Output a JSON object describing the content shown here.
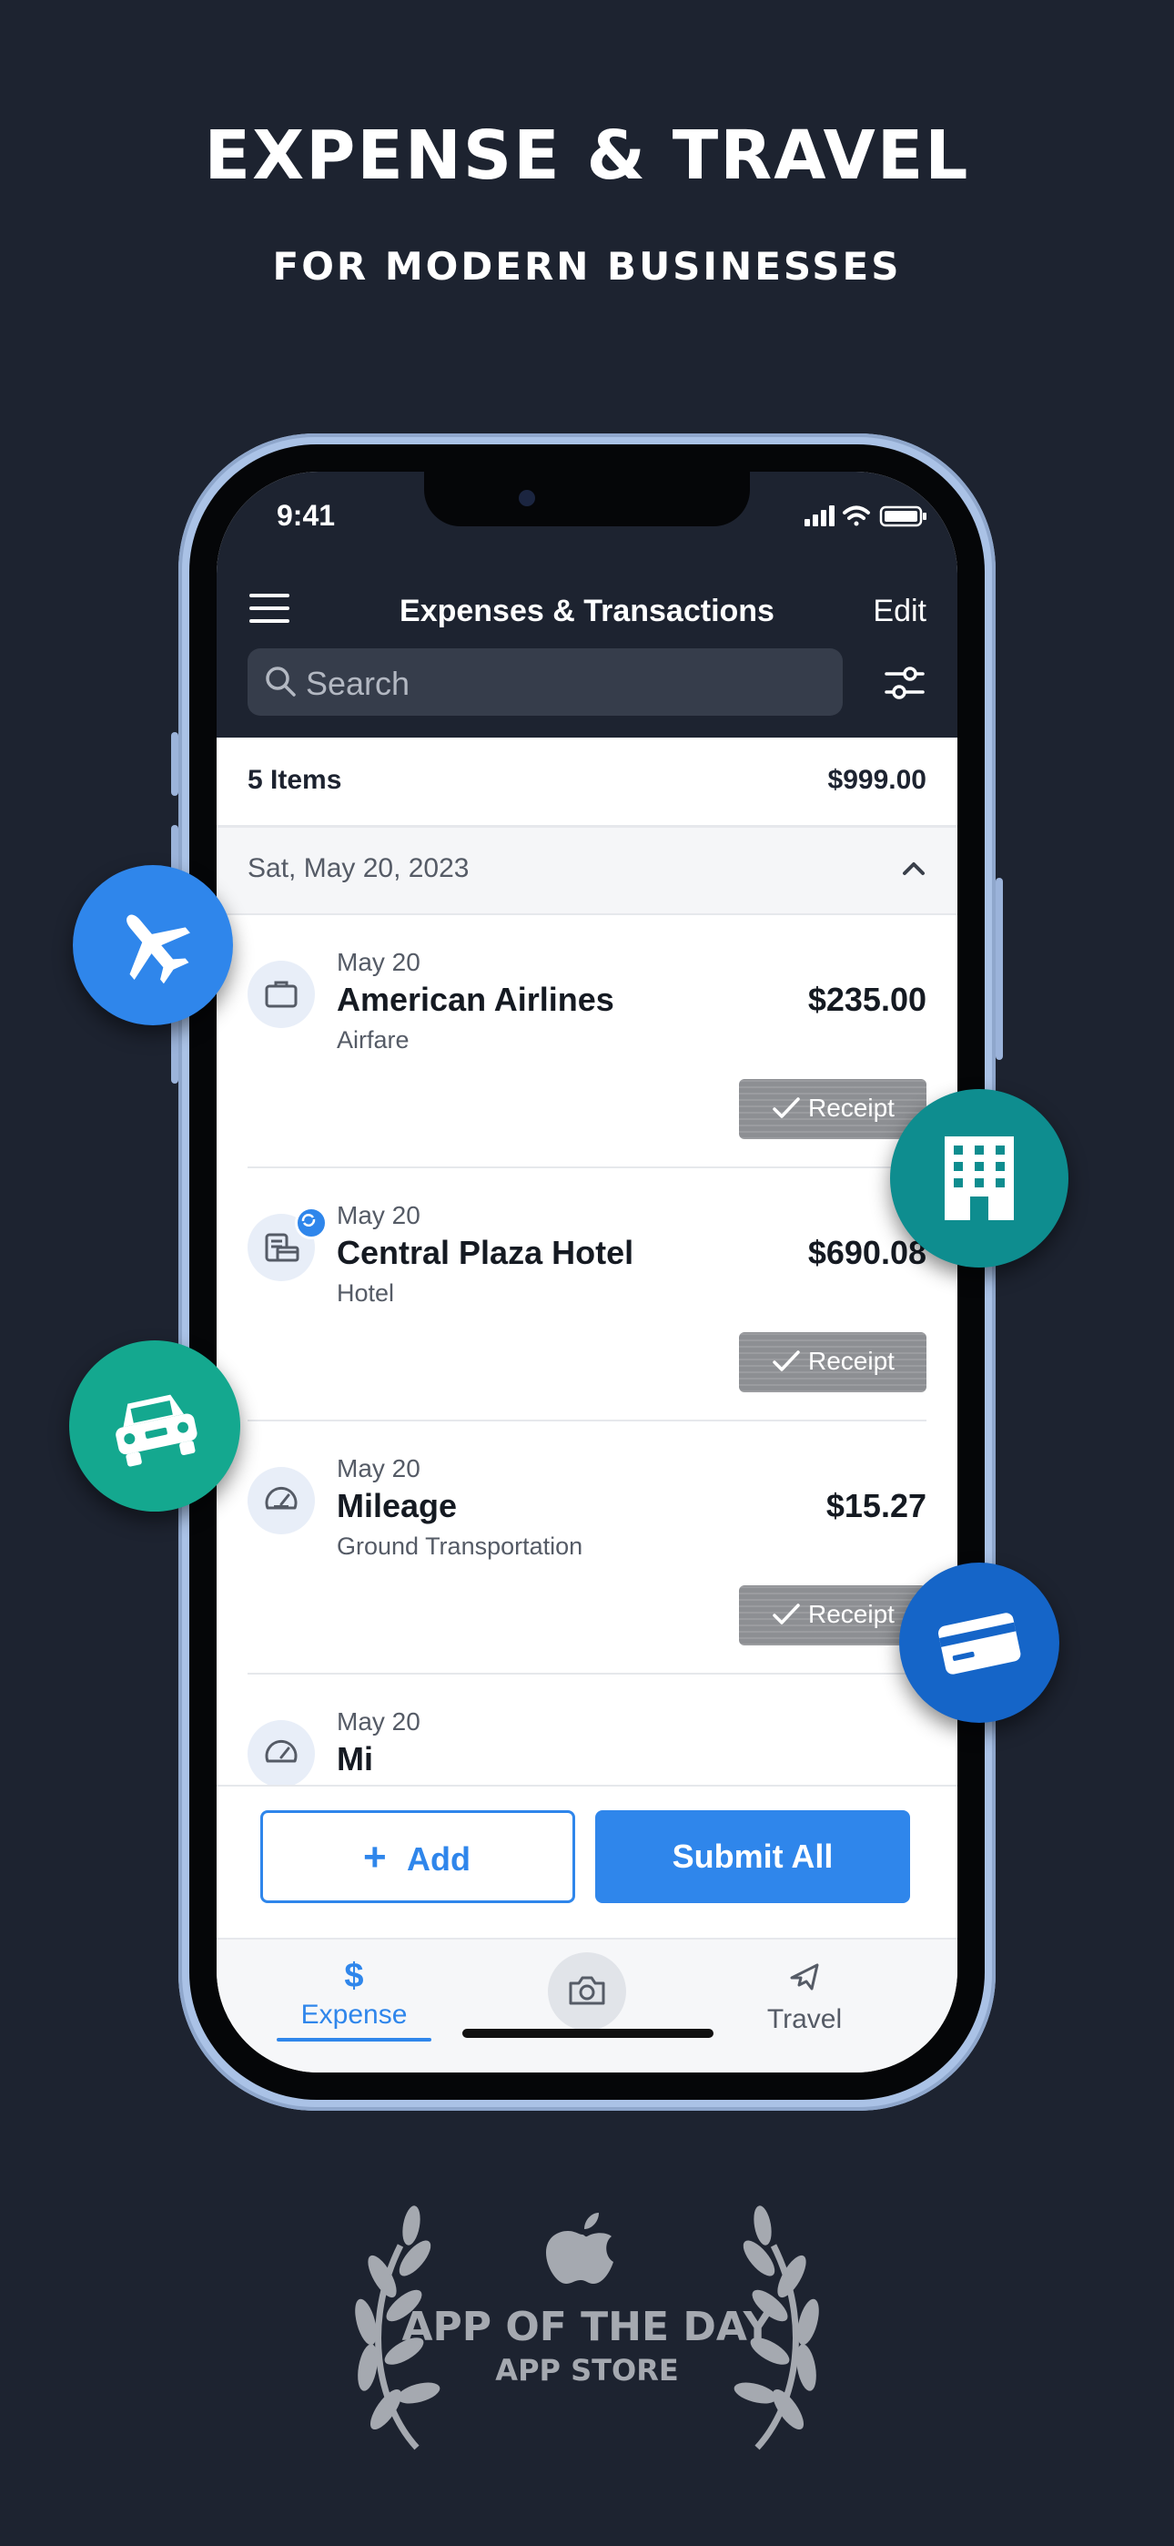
{
  "headline": "EXPENSE & TRAVEL",
  "subheadline": "FOR MODERN BUSINESSES",
  "phone": {
    "status_time": "9:41",
    "nav": {
      "title": "Expenses & Transactions",
      "edit_label": "Edit"
    },
    "search": {
      "placeholder": "Search"
    },
    "summary": {
      "count": "5 Items",
      "total": "$999.00"
    },
    "date_header": "Sat, May 20, 2023",
    "items": [
      {
        "date": "May 20",
        "title": "American Airlines",
        "category": "Airfare",
        "amount": "$235.00",
        "receipt_label": "Receipt",
        "icon": "briefcase-icon"
      },
      {
        "date": "May 20",
        "title": "Central Plaza Hotel",
        "category": "Hotel",
        "amount": "$690.08",
        "receipt_label": "Receipt",
        "icon": "card-reader-icon"
      },
      {
        "date": "May 20",
        "title": "Mileage",
        "category": "Ground Transportation",
        "amount": "$15.27",
        "receipt_label": "Receipt",
        "icon": "speedometer-icon"
      },
      {
        "date": "May 20",
        "title": "Mi",
        "category": "",
        "amount": "",
        "receipt_label": "",
        "icon": "speedometer-icon"
      }
    ],
    "actions": {
      "add_plus": "+",
      "add_label": "Add",
      "submit_label": "Submit All"
    },
    "tabs": {
      "expense_symbol": "$",
      "expense_label": "Expense",
      "travel_label": "Travel"
    }
  },
  "floating_icons": [
    "airplane-icon",
    "building-icon",
    "car-icon",
    "credit-card-icon"
  ],
  "colors": {
    "background": "#1d2330",
    "accent_blue": "#2f86eb",
    "teal": "#0e8d8f",
    "green": "#14a88f",
    "card_blue": "#1565c8"
  },
  "award": {
    "title": "APP OF THE DAY",
    "subtitle": "APP STORE"
  }
}
